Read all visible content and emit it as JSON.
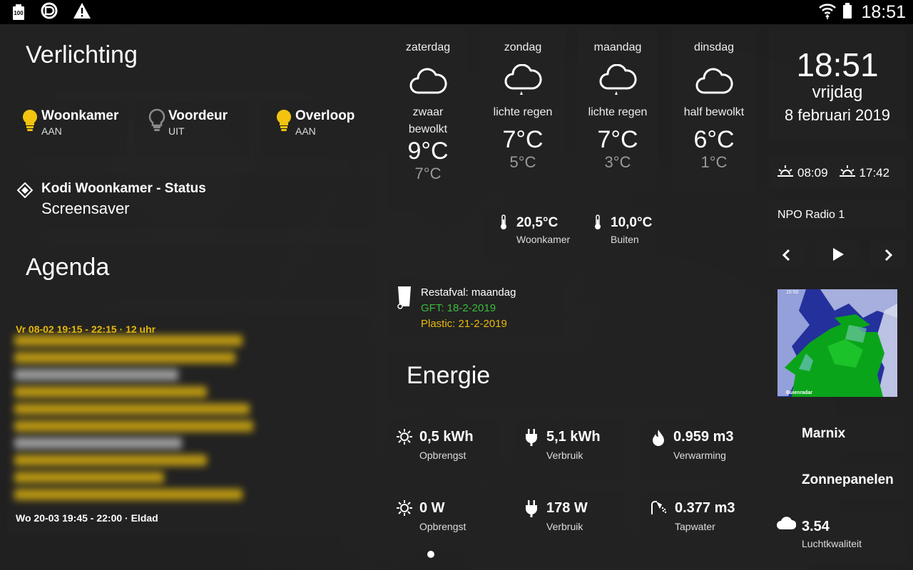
{
  "statusbar": {
    "battery_level": "100",
    "time": "18:51"
  },
  "lights": {
    "title": "Verlichting",
    "items": [
      {
        "name": "Woonkamer",
        "state": "AAN"
      },
      {
        "name": "Voordeur",
        "state": "UIT"
      },
      {
        "name": "Overloop",
        "state": "AAN"
      }
    ]
  },
  "kodi": {
    "title": "Kodi Woonkamer - Status",
    "status": "Screensaver"
  },
  "agenda": {
    "title": "Agenda",
    "first_visible": "Vr 08-02 19:15 - 22:15 · 12 uhr",
    "last_visible": "Wo 20-03 19:45 - 22:00 · Eldad"
  },
  "weather": {
    "days": [
      {
        "day": "zaterdag",
        "desc_line1": "zwaar",
        "desc_line2": "bewolkt",
        "high": "9°C",
        "low": "7°C",
        "icon": "cloud-icon"
      },
      {
        "day": "zondag",
        "desc_line1": "lichte regen",
        "desc_line2": "",
        "high": "7°C",
        "low": "5°C",
        "icon": "light-rain-icon"
      },
      {
        "day": "maandag",
        "desc_line1": "lichte regen",
        "desc_line2": "",
        "high": "7°C",
        "low": "3°C",
        "icon": "light-rain-icon"
      },
      {
        "day": "dinsdag",
        "desc_line1": "half bewolkt",
        "desc_line2": "",
        "high": "6°C",
        "low": "1°C",
        "icon": "cloud-icon"
      }
    ]
  },
  "temperatures": [
    {
      "value": "20,5°C",
      "label": "Woonkamer"
    },
    {
      "value": "10,0°C",
      "label": "Buiten"
    }
  ],
  "waste": {
    "rest": "Restafval: maandag",
    "gft": "GFT: 18-2-2019",
    "plastic": "Plastic: 21-2-2019",
    "gft_color": "#3dbb3d",
    "plastic_color": "#e8b90c"
  },
  "energy": {
    "title": "Energie",
    "tiles": [
      {
        "value": "0,5 kWh",
        "label": "Opbrengst",
        "icon": "sun-icon"
      },
      {
        "value": "5,1 kWh",
        "label": "Verbruik",
        "icon": "plug-icon"
      },
      {
        "value": "0.959 m3",
        "label": "Verwarming",
        "icon": "flame-icon"
      },
      {
        "value": "0 W",
        "label": "Opbrengst",
        "icon": "sun-icon"
      },
      {
        "value": "178 W",
        "label": "Verbruik",
        "icon": "plug-icon"
      },
      {
        "value": "0.377 m3",
        "label": "Tapwater",
        "icon": "shower-icon"
      }
    ]
  },
  "clock": {
    "time": "18:51",
    "weekday": "vrijdag",
    "date": "8 februari 2019"
  },
  "sun": {
    "sunrise": "08:09",
    "sunset": "17:42"
  },
  "radio": {
    "station": "NPO Radio 1"
  },
  "radar": {
    "timestamp": "15:50",
    "brand": "Buienradar"
  },
  "buttons": {
    "marnix": "Marnix",
    "zonnepanelen": "Zonnepanelen"
  },
  "air": {
    "value": "3.54",
    "label": "Luchtkwaliteit"
  },
  "colors": {
    "bulb_on": "#f2c40f",
    "bulb_off": "#8a8a8a",
    "agenda_highlight": "#e8b90c"
  }
}
